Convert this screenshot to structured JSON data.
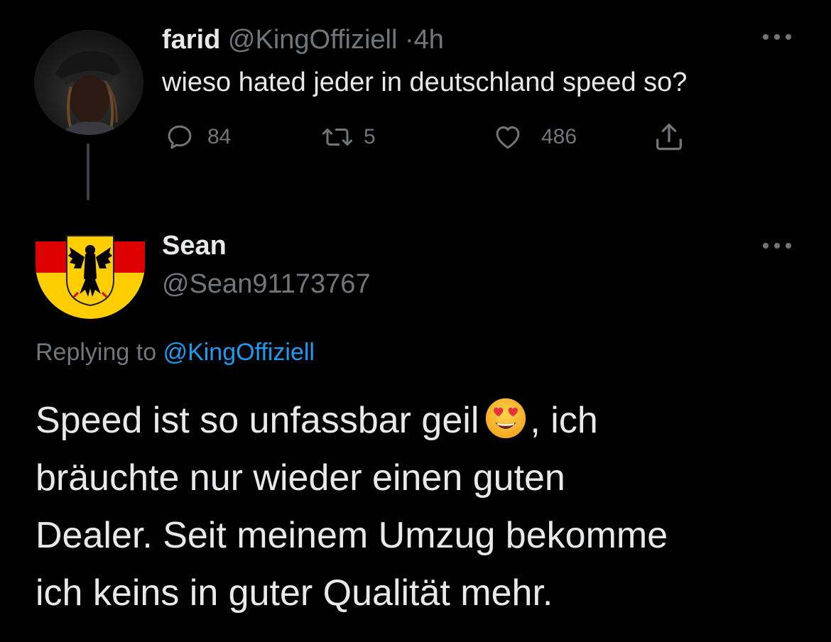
{
  "tweet_1": {
    "name": "farid",
    "handle": "@KingOffiziell",
    "separator": "·",
    "time": "4h",
    "text": "wieso hated jeder in deutschland speed so?",
    "actions": {
      "replies": "84",
      "retweets": "5",
      "likes": "486"
    }
  },
  "tweet_2": {
    "name": "Sean",
    "handle": "@Sean91173767",
    "replying_prefix": "Replying to",
    "replying_handle": "@KingOffiziell",
    "text_line_1_before_emoji": "Speed ist so unfassbar geil",
    "emoji": "smiling-face-with-heart-eyes",
    "text_line_1_after_emoji": ", ich",
    "text_line_2": "bräuchte nur wieder einen guten",
    "text_line_3": "Dealer. Seit meinem Umzug bekomme",
    "text_line_4": "ich keins in guter Qualität mehr."
  },
  "colors": {
    "background": "#000000",
    "text_primary": "#e7e9ea",
    "text_secondary": "#71767b",
    "link": "#1d9bf0",
    "thread_line": "#3d4146"
  }
}
